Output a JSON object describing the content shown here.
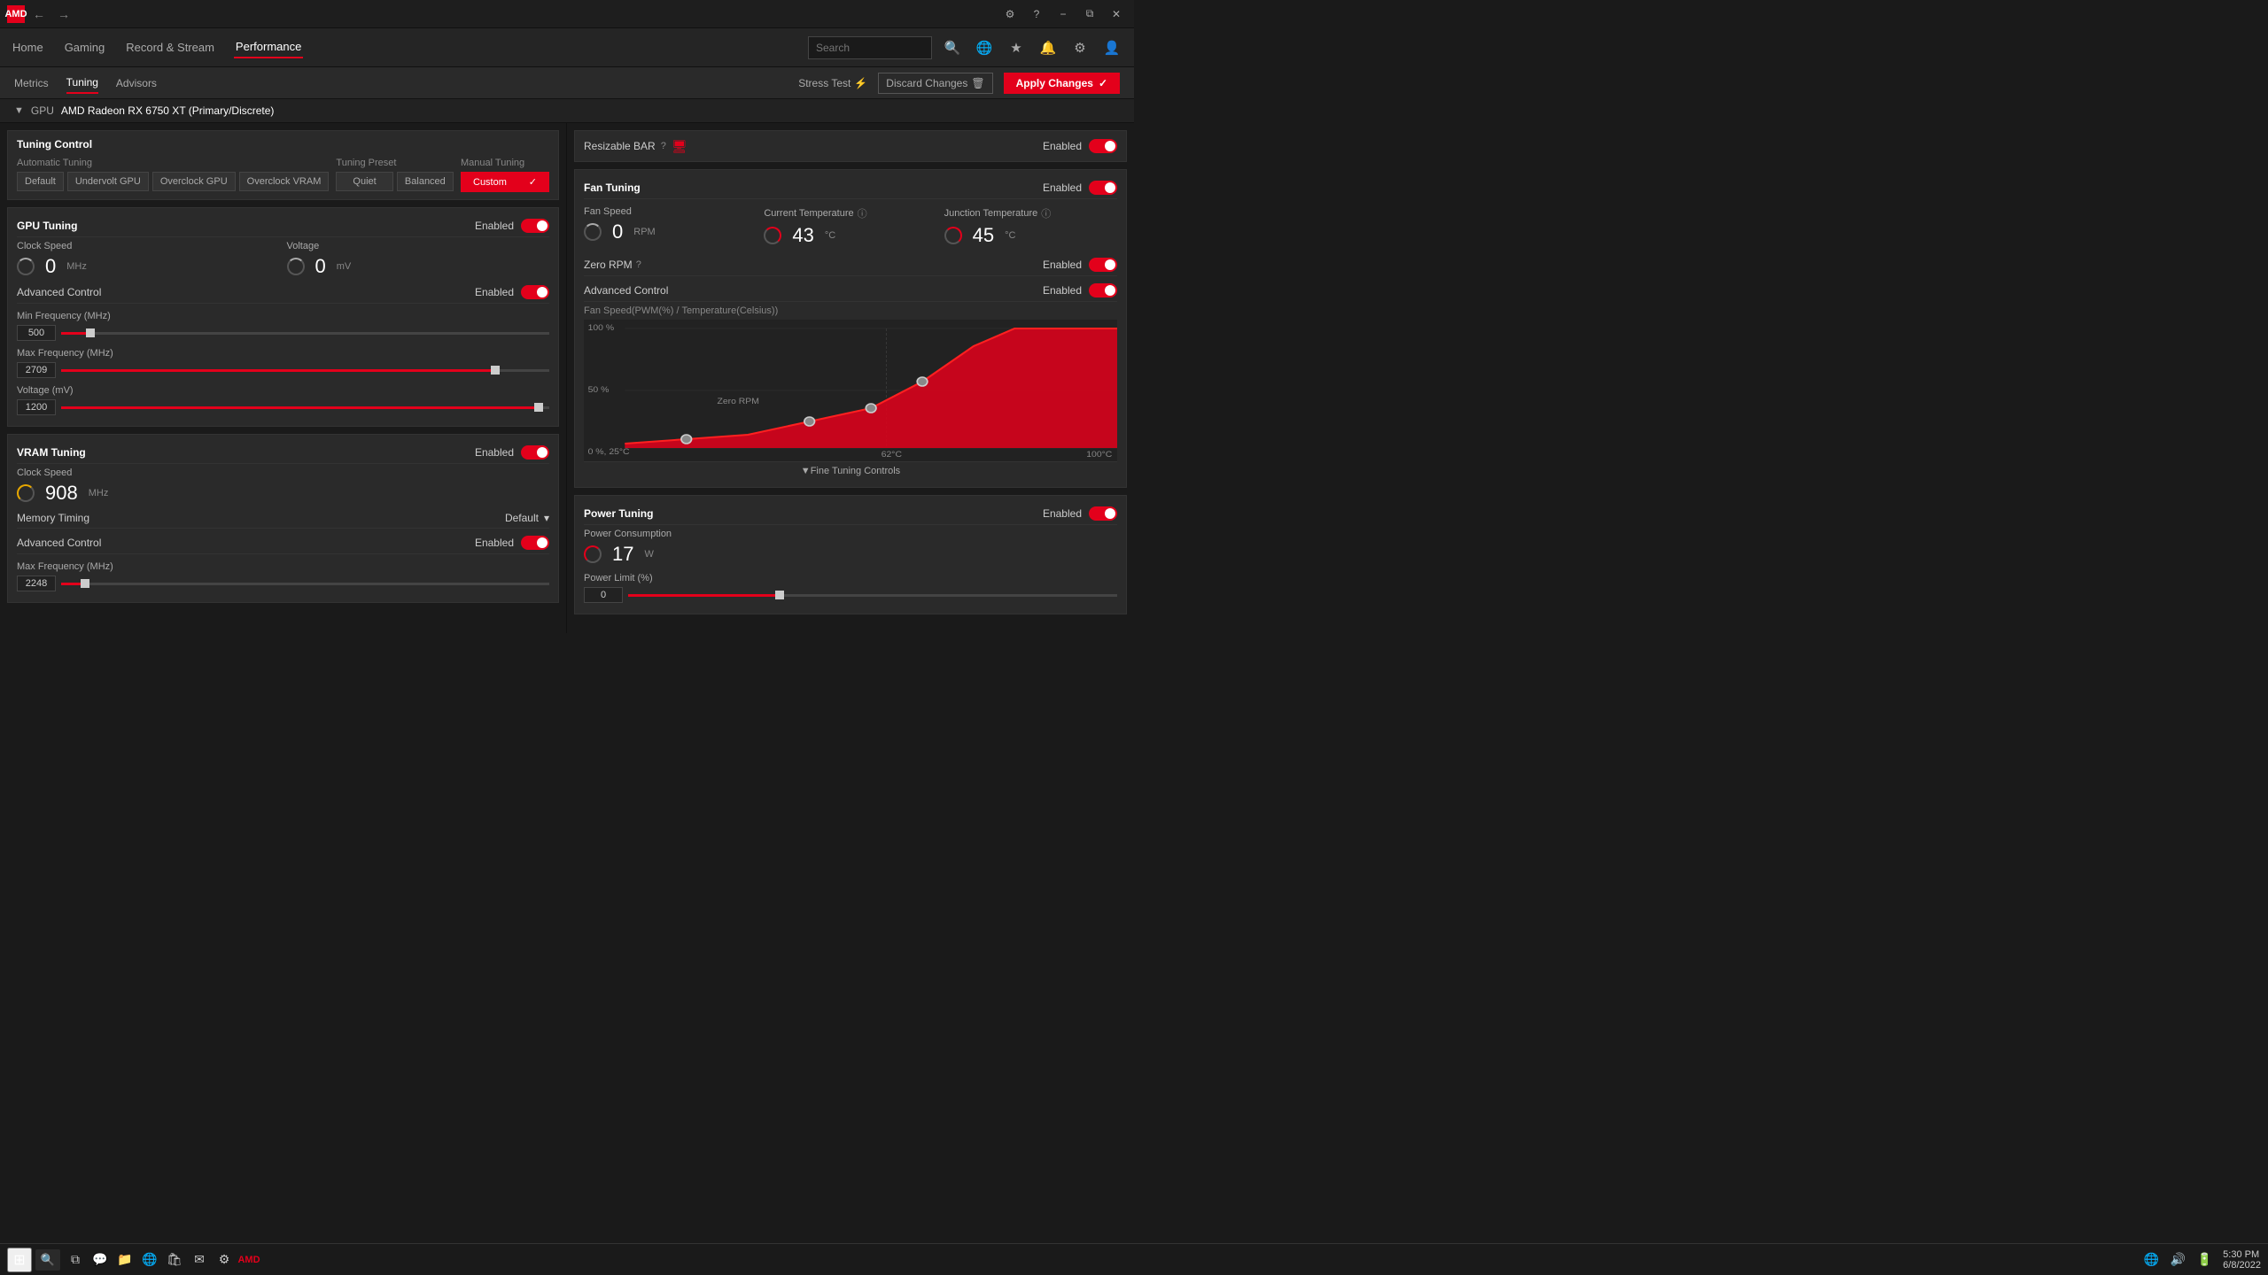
{
  "titlebar": {
    "app_icon": "AMD",
    "win_minimize": "−",
    "win_restore": "⧉",
    "win_close": "✕"
  },
  "top_nav": {
    "home": "Home",
    "gaming": "Gaming",
    "record_stream": "Record & Stream",
    "performance": "Performance",
    "search_placeholder": "Search"
  },
  "sub_nav": {
    "metrics": "Metrics",
    "tuning": "Tuning",
    "advisors": "Advisors",
    "stress_test": "Stress Test",
    "discard": "Discard Changes",
    "apply": "Apply Changes"
  },
  "gpu_header": {
    "label": "GPU",
    "name": "AMD Radeon RX 6750 XT (Primary/Discrete)"
  },
  "tuning_control": {
    "title": "Tuning Control",
    "auto_label": "Automatic Tuning",
    "auto_btns": [
      "Default",
      "Undervolt GPU",
      "Overclock GPU",
      "Overclock VRAM"
    ],
    "preset_label": "Tuning Preset",
    "preset_btns": [
      "Quiet",
      "Balanced"
    ],
    "manual_label": "Manual Tuning",
    "manual_btn": "Custom"
  },
  "gpu_tuning": {
    "title": "GPU Tuning",
    "enabled_label": "Enabled",
    "clock_speed_label": "Clock Speed",
    "clock_value": "0",
    "clock_unit": "MHz",
    "voltage_label": "Voltage",
    "voltage_value": "0",
    "voltage_unit": "mV",
    "advanced_label": "Advanced Control",
    "advanced_value": "Enabled",
    "min_freq_label": "Min Frequency (MHz)",
    "min_freq_value": "500",
    "min_freq_pct": 5,
    "max_freq_label": "Max Frequency (MHz)",
    "max_freq_value": "2709",
    "max_freq_pct": 88,
    "voltage_mv_label": "Voltage (mV)",
    "voltage_mv_value": "1200",
    "voltage_mv_pct": 97
  },
  "vram_tuning": {
    "title": "VRAM Tuning",
    "enabled_label": "Enabled",
    "clock_label": "Clock Speed",
    "clock_value": "908",
    "clock_unit": "MHz",
    "memory_timing_label": "Memory Timing",
    "memory_timing_value": "Default",
    "advanced_label": "Advanced Control",
    "advanced_value": "Enabled",
    "max_freq_label": "Max Frequency (MHz)",
    "max_freq_value": "2248",
    "max_freq_pct": 4
  },
  "resizable_bar": {
    "label": "Resizable BAR",
    "value": "Enabled"
  },
  "fan_tuning": {
    "title": "Fan Tuning",
    "enabled_label": "Enabled",
    "fan_speed_label": "Fan Speed",
    "fan_rpm": "0",
    "fan_unit": "RPM",
    "current_temp_label": "Current Temperature",
    "current_temp": "43",
    "current_temp_unit": "°C",
    "junction_temp_label": "Junction Temperature",
    "junction_temp": "45",
    "junction_temp_unit": "°C",
    "zero_rpm_label": "Zero RPM",
    "zero_rpm_value": "Enabled",
    "advanced_label": "Advanced Control",
    "advanced_value": "Enabled",
    "chart_title": "Fan Speed(PWM(%) / Temperature(Celsius))",
    "chart_y_100": "100 %",
    "chart_y_50": "50 %",
    "chart_y_0": "0 %, 25°C",
    "chart_x_62": "62°C",
    "chart_x_100": "100°C",
    "zero_rpm_text": "Zero RPM",
    "fine_tuning": "Fine Tuning Controls"
  },
  "power_tuning": {
    "title": "Power Tuning",
    "enabled_label": "Enabled",
    "power_consumption_label": "Power Consumption",
    "power_value": "17",
    "power_unit": "W",
    "power_limit_label": "Power Limit (%)",
    "power_limit_value": "0",
    "power_limit_pct": 30
  },
  "taskbar": {
    "time": "5:30 PM",
    "date": "6/8/2022"
  }
}
